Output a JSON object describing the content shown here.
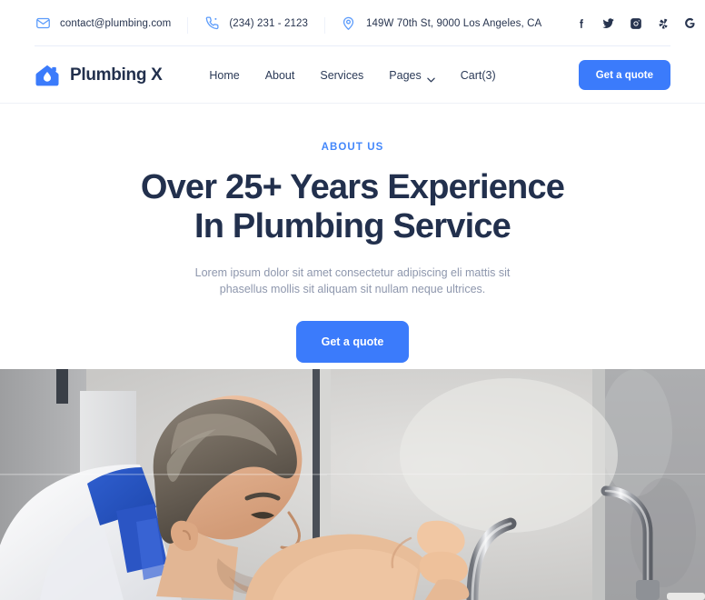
{
  "topbar": {
    "contacts": [
      {
        "icon": "mail-icon",
        "text": "contact@plumbing.com"
      },
      {
        "icon": "phone-icon",
        "text": "(234) 231 - 2123"
      },
      {
        "icon": "location-pin-icon",
        "text": "149W 70th St, 9000 Los Angeles, CA"
      }
    ],
    "social": [
      {
        "icon": "facebook-icon",
        "label": "Facebook"
      },
      {
        "icon": "twitter-icon",
        "label": "Twitter"
      },
      {
        "icon": "instagram-icon",
        "label": "Instagram"
      },
      {
        "icon": "yelp-icon",
        "label": "Yelp"
      },
      {
        "icon": "google-icon",
        "label": "Google"
      }
    ]
  },
  "header": {
    "brand": {
      "name": "Plumbing X",
      "icon": "house-water-drop-logo-icon"
    },
    "nav": [
      {
        "label": "Home",
        "has_dropdown": false
      },
      {
        "label": "About",
        "has_dropdown": false
      },
      {
        "label": "Services",
        "has_dropdown": false
      },
      {
        "label": "Pages",
        "has_dropdown": true
      },
      {
        "label": "Cart(3)",
        "has_dropdown": false
      }
    ],
    "cta_label": "Get a quote"
  },
  "hero": {
    "eyebrow": "ABOUT US",
    "title_line1": "Over 25+ Years Experience",
    "title_line2": "In Plumbing Service",
    "subtitle": "Lorem ipsum dolor sit amet consectetur adipiscing eli mattis sit phasellus mollis sit aliquam sit nullam neque ultrices.",
    "cta_label": "Get a quote"
  },
  "photo": {
    "alt": "Plumber in white shirt and blue overalls inspecting a chrome kitchen faucet"
  },
  "colors": {
    "accent_blue": "#3b7bfb",
    "eyebrow_blue": "#4387fb",
    "heading_navy": "#22304d",
    "body_gray": "#8e97ad",
    "nav_text": "#2b3a57",
    "divider": "#eef1f7"
  }
}
